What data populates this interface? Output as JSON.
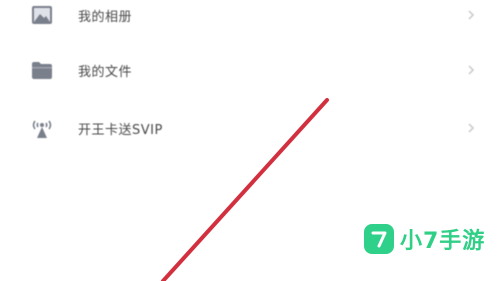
{
  "menu": {
    "items": [
      {
        "label": "我的相册",
        "icon": "photo-album-icon"
      },
      {
        "label": "我的文件",
        "icon": "folder-icon"
      },
      {
        "label": "开王卡送SVIP",
        "icon": "signal-tower-icon"
      }
    ]
  },
  "watermark": {
    "text": "小7手游",
    "logo_glyph": "7",
    "color": "#2fd08a"
  },
  "overlay": {
    "slash_color": "#d2303f"
  }
}
